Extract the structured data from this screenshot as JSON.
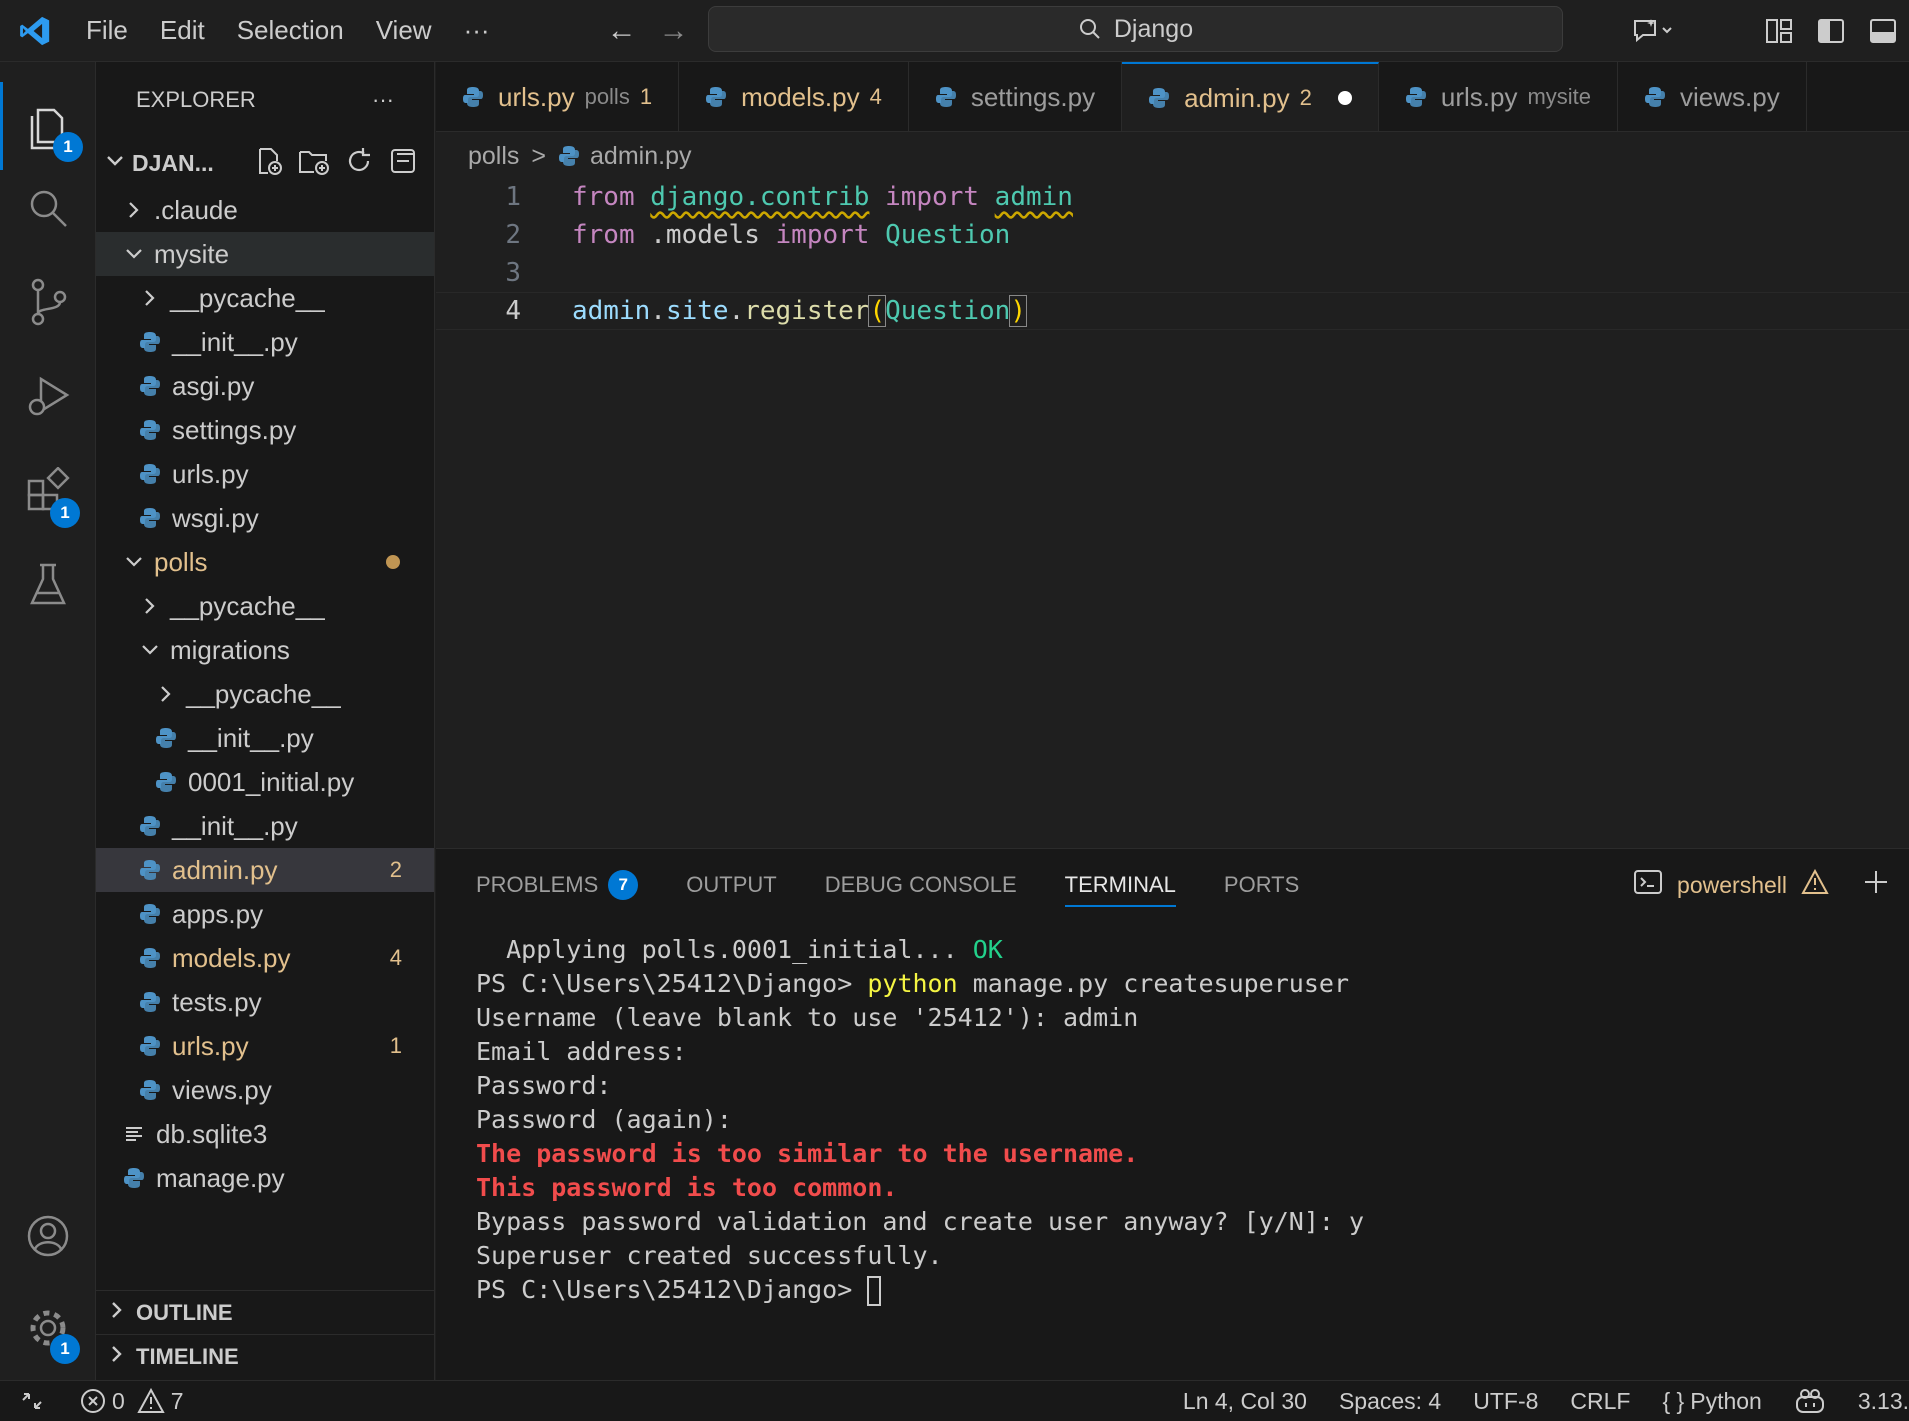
{
  "menu": [
    "File",
    "Edit",
    "Selection",
    "View",
    "···"
  ],
  "search": {
    "text": "Django"
  },
  "activity": {
    "explorer_badge": "1",
    "extensions_badge": "1",
    "settings_badge": "1"
  },
  "sidebar": {
    "title": "EXPLORER",
    "more": "···",
    "project": "DJAN...",
    "tree": [
      {
        "label": ".claude",
        "type": "folder",
        "open": false,
        "depth": 1
      },
      {
        "label": "mysite",
        "type": "folder",
        "open": true,
        "depth": 1
      },
      {
        "label": "__pycache__",
        "type": "folder",
        "open": false,
        "depth": 2
      },
      {
        "label": "__init__.py",
        "type": "py",
        "depth": 2
      },
      {
        "label": "asgi.py",
        "type": "py",
        "depth": 2
      },
      {
        "label": "settings.py",
        "type": "py",
        "depth": 2
      },
      {
        "label": "urls.py",
        "type": "py",
        "depth": 2
      },
      {
        "label": "wsgi.py",
        "type": "py",
        "depth": 2
      },
      {
        "label": "polls",
        "type": "folder",
        "open": true,
        "depth": 1
      },
      {
        "label": "__pycache__",
        "type": "folder",
        "open": false,
        "depth": 2
      },
      {
        "label": "migrations",
        "type": "folder",
        "open": true,
        "depth": 2
      },
      {
        "label": "__pycache__",
        "type": "folder",
        "open": false,
        "depth": 3
      },
      {
        "label": "__init__.py",
        "type": "py",
        "depth": 3
      },
      {
        "label": "0001_initial.py",
        "type": "py",
        "depth": 3
      },
      {
        "label": "__init__.py",
        "type": "py",
        "depth": 2
      },
      {
        "label": "admin.py",
        "type": "py",
        "depth": 2,
        "count": "2"
      },
      {
        "label": "apps.py",
        "type": "py",
        "depth": 2
      },
      {
        "label": "models.py",
        "type": "py",
        "depth": 2,
        "count": "4"
      },
      {
        "label": "tests.py",
        "type": "py",
        "depth": 2
      },
      {
        "label": "urls.py",
        "type": "py",
        "depth": 2,
        "count": "1"
      },
      {
        "label": "views.py",
        "type": "py",
        "depth": 2
      },
      {
        "label": "db.sqlite3",
        "type": "db",
        "depth": 1
      },
      {
        "label": "manage.py",
        "type": "py",
        "depth": 1
      }
    ],
    "outline": "OUTLINE",
    "timeline": "TIMELINE"
  },
  "tabs": [
    {
      "label": "urls.py",
      "desc": "polls",
      "num": "1"
    },
    {
      "label": "models.py",
      "num": "4"
    },
    {
      "label": "settings.py"
    },
    {
      "label": "admin.py",
      "num": "2"
    },
    {
      "label": "urls.py",
      "desc": "mysite"
    },
    {
      "label": "views.py"
    }
  ],
  "breadcrumb": {
    "folder": "polls",
    "sep": ">",
    "file": "admin.py"
  },
  "editor": {
    "line_numbers": [
      "1",
      "2",
      "3",
      "4"
    ],
    "l1": {
      "from": "from",
      "module": "django.contrib",
      "import": "import",
      "name": "admin"
    },
    "l2": {
      "from": "from",
      "module": ".models",
      "import": "import",
      "name": "Question"
    },
    "l4": {
      "obj": "admin",
      "dot1": ".",
      "attr": "site",
      "dot2": ".",
      "fn": "register",
      "open": "(",
      "arg": "Question",
      "close": ")"
    }
  },
  "panel": {
    "tabs": [
      "PROBLEMS",
      "OUTPUT",
      "DEBUG CONSOLE",
      "TERMINAL",
      "PORTS"
    ],
    "problems_badge": "7",
    "shell": "powershell"
  },
  "terminal": {
    "l1a": "  Applying polls.0001_initial... ",
    "l1b": "OK",
    "prompt": "PS C:\\Users\\25412\\Django> ",
    "cmd_python": "python",
    "cmd_rest": " manage.py createsuperuser",
    "l3": "Username (leave blank to use '25412'): admin",
    "l4": "Email address:",
    "l5": "Password:",
    "l6": "Password (again):",
    "l7": "The password is too similar to the username.",
    "l8": "This password is too common.",
    "l9": "Bypass password validation and create user anyway? [y/N]: y",
    "l10": "Superuser created successfully."
  },
  "status": {
    "errors": "0",
    "warnings": "7",
    "position": "Ln 4, Col 30",
    "spaces": "Spaces: 4",
    "encoding": "UTF-8",
    "eol": "CRLF",
    "lang_icon": "{ }",
    "language": "Python",
    "version": "3.13."
  },
  "colors": {
    "accent": "#0078d4",
    "modified": "#e2c08d",
    "error": "#f14c4c",
    "ok": "#23d18b"
  }
}
